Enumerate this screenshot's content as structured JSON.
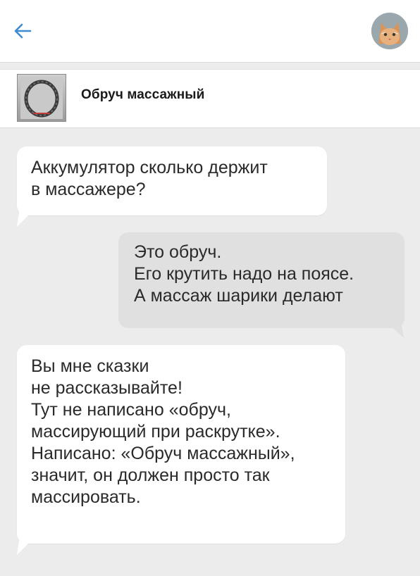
{
  "header": {
    "back_icon": "arrow-left-icon",
    "accent": "#3f8bcf",
    "avatar_icon": "user-avatar-cat"
  },
  "product": {
    "title": "Обруч массажный",
    "thumb_icon": "hoop-thumbnail"
  },
  "messages": [
    {
      "side": "incoming",
      "lines": [
        "Аккумулятор сколько держит",
        "в массажере?"
      ]
    },
    {
      "side": "outgoing",
      "lines": [
        "Это обруч.",
        "Его крутить надо на поясе.",
        "А массаж шарики делают"
      ]
    },
    {
      "side": "incoming",
      "lines": [
        "Вы мне сказки",
        "не рассказывайте!",
        "Тут не написано «обруч,",
        "массирующий при раскрутке».",
        "Написано: «Обруч массажный»,",
        "значит, он должен просто так",
        "массировать."
      ]
    }
  ]
}
